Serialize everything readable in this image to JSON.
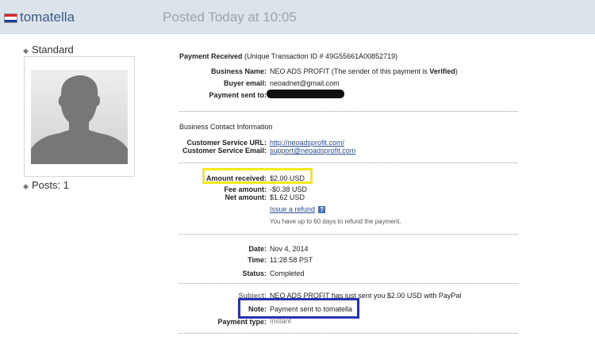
{
  "header": {
    "username": "tomatella",
    "posted": "Posted Today at 10:05"
  },
  "profile": {
    "rank": "Standard",
    "posts": "Posts: 1"
  },
  "payment": {
    "title_bold": "Payment Received",
    "title_rest": " (Unique Transaction ID # 49G55661A00852719)",
    "business_name_label": "Business Name:",
    "business_name_value": "NEO ADS PROFIT (The sender of this payment is ",
    "business_name_verified": "Verified",
    "business_name_end": ")",
    "buyer_email_label": "Buyer email:",
    "buyer_email_value": "neoadnet@gmail.com",
    "sent_to_label": "Payment sent to:",
    "contact_heading": "Business Contact Information",
    "service_url_label": "Customer Service URL:",
    "service_url_value": "http://neoadsprofit.com/",
    "service_email_label": "Customer Service Email:",
    "service_email_value": "support@neoadsprofit.com",
    "amount_label": "Amount received:",
    "amount_value": "$2.00 USD",
    "fee_label": "Fee amount:",
    "fee_value": "-$0.38 USD",
    "net_label": "Net amount:",
    "net_value": "$1.62 USD",
    "refund_link": "Issue a refund",
    "refund_note": "You have up to 60 days to refund the payment.",
    "date_label": "Date:",
    "date_value": "Nov 4, 2014",
    "time_label": "Time:",
    "time_value": "11:28:58 PST",
    "status_label": "Status:",
    "status_value": "Completed",
    "subject_label": "Subject:",
    "subject_value": "NEO ADS PROFIT has just sent you $2.00 USD with PayPal",
    "note_label": "Note:",
    "note_value": "Payment sent to tomatella",
    "payment_type_label": "Payment type:",
    "payment_type_value": "Instant"
  },
  "colors": {
    "highlight_amount": "#f4e818",
    "highlight_note": "#2732b5",
    "header_bg": "#dde3ea"
  }
}
